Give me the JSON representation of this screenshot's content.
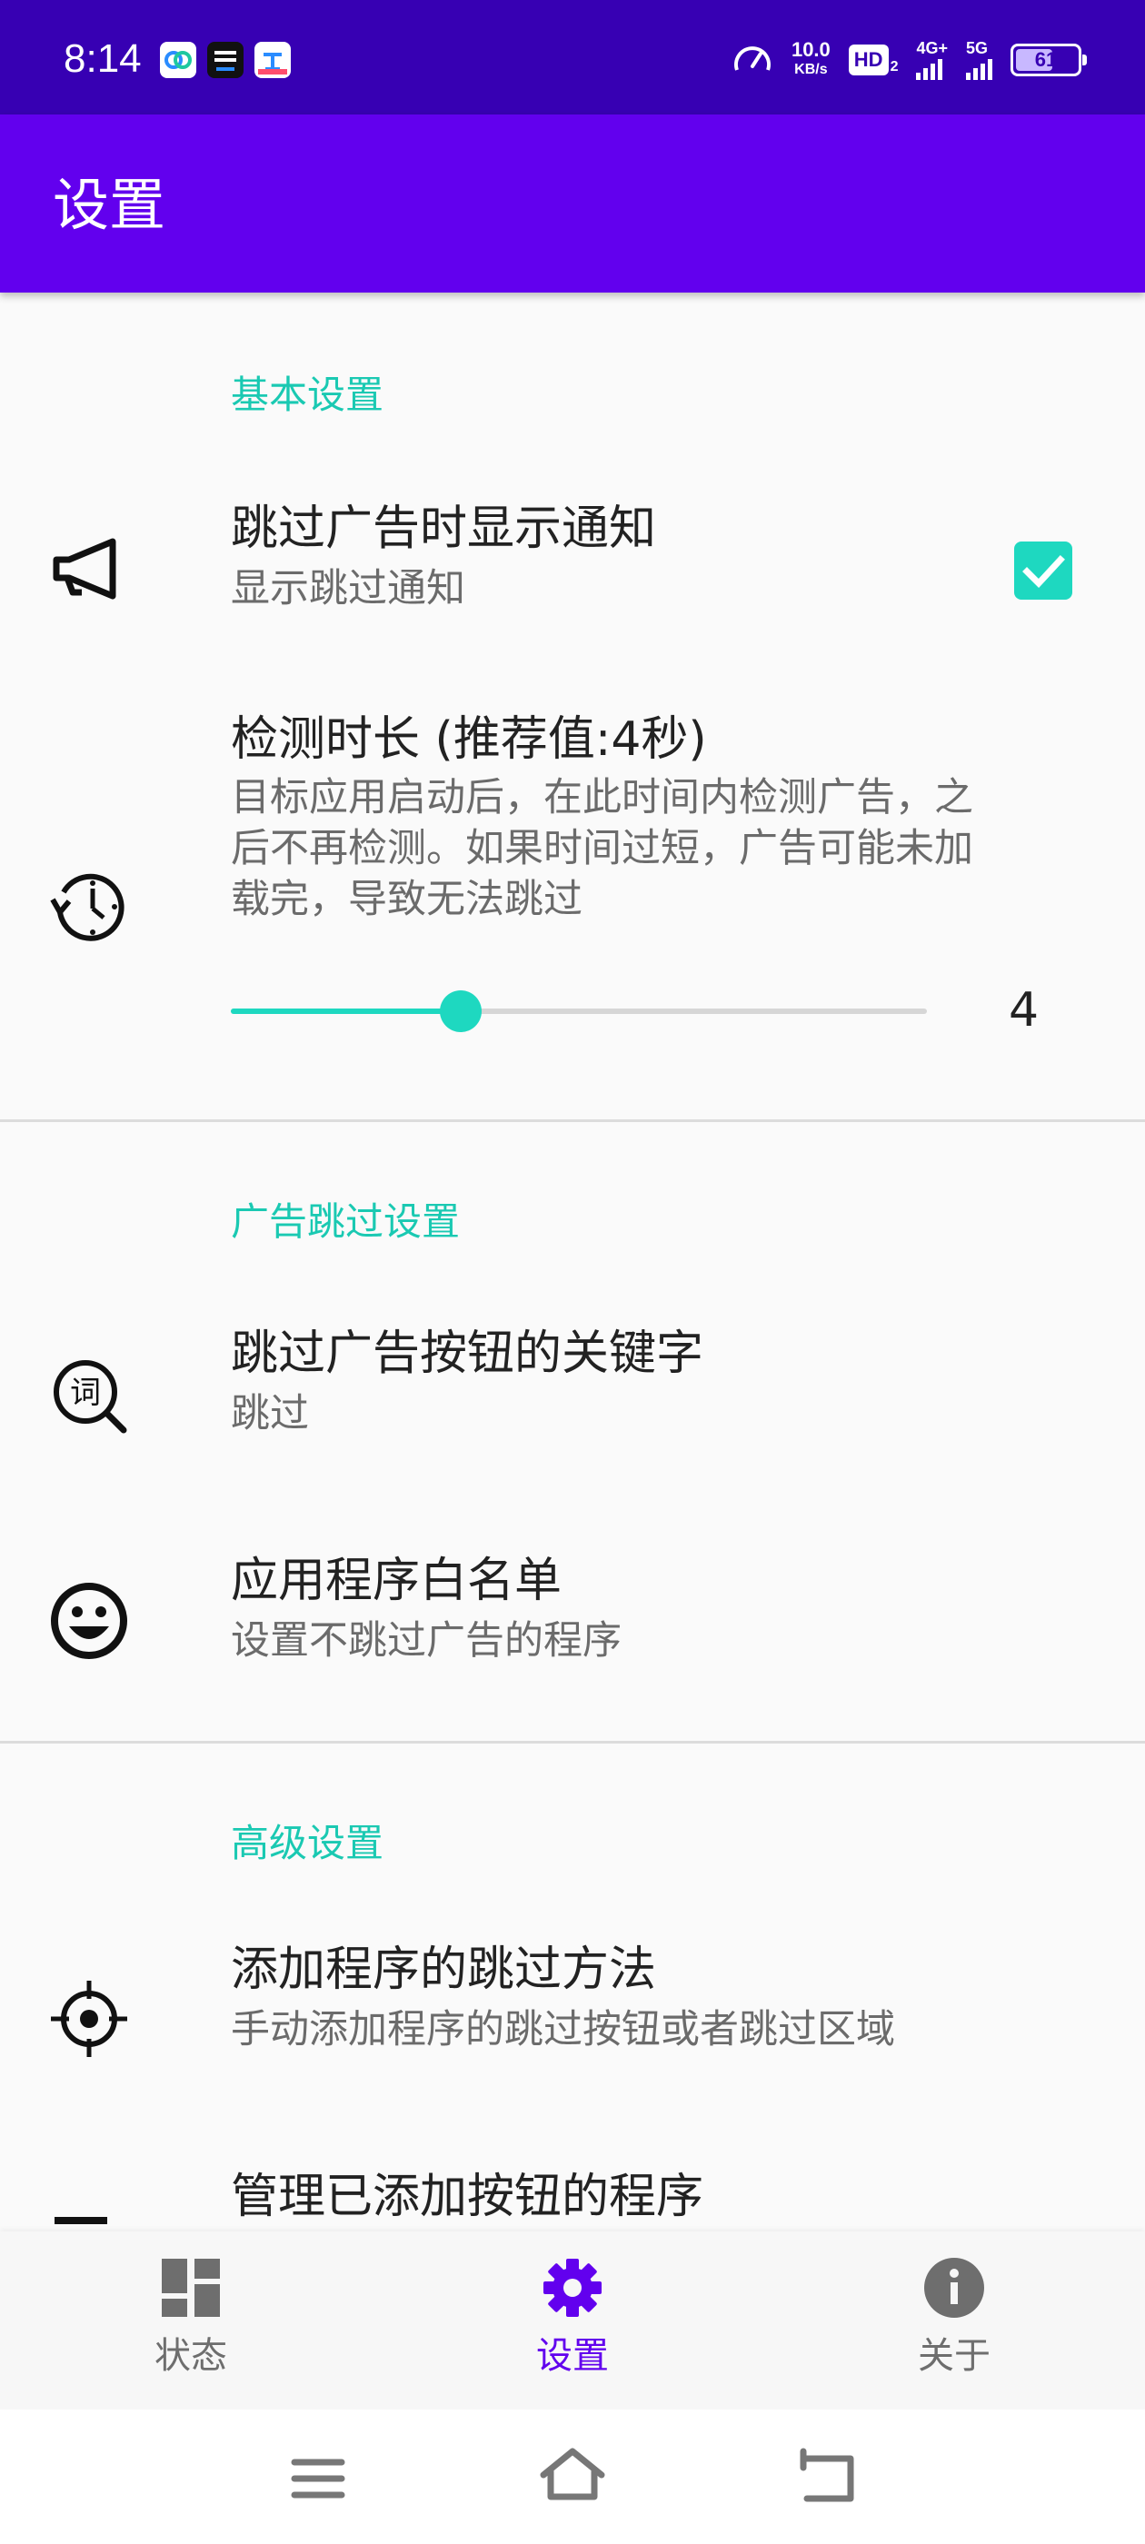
{
  "status_bar": {
    "time": "8:14",
    "net_speed_value": "10.0",
    "net_speed_unit": "KB/s",
    "hd_label": "HD",
    "hd_sub": "2",
    "signal1_label": "4G+",
    "signal2_label": "5G",
    "battery_level": "61"
  },
  "app_bar": {
    "title": "设置"
  },
  "sections": {
    "basic": {
      "title": "基本设置",
      "notify": {
        "title": "跳过广告时显示通知",
        "summary": "显示跳过通知",
        "checked": true,
        "icon": "megaphone-icon"
      },
      "duration": {
        "title": "检测时长 (推荐值:4秒)",
        "summary_line1": "目标应用启动后，在此时间内检测广告，之",
        "summary_line2": "后不再检测。如果时间过短，广告可能未加",
        "summary_line3": "载完，导致无法跳过",
        "slider_fraction": 0.33,
        "value": "4",
        "icon": "timer-history-icon"
      }
    },
    "skip": {
      "title": "广告跳过设置",
      "keywords": {
        "title": "跳过广告按钮的关键字",
        "summary": "跳过",
        "icon": "keyword-search-icon"
      },
      "whitelist": {
        "title": "应用程序白名单",
        "summary": "设置不跳过广告的程序",
        "icon": "smiley-icon"
      }
    },
    "advanced": {
      "title": "高级设置",
      "add_method": {
        "title": "添加程序的跳过方法",
        "summary": "手动添加程序的跳过按钮或者跳过区域",
        "icon": "crosshair-icon"
      },
      "manage": {
        "title": "管理已添加按钮的程序",
        "icon": "list-icon"
      }
    }
  },
  "bottom_nav": {
    "items": [
      {
        "label": "状态",
        "icon": "dashboard-icon"
      },
      {
        "label": "设置",
        "icon": "gear-icon",
        "active": true
      },
      {
        "label": "关于",
        "icon": "info-icon"
      }
    ]
  },
  "colors": {
    "primary": "#6200ee",
    "primary_dark": "#3700b3",
    "accent": "#1ed8c0"
  }
}
